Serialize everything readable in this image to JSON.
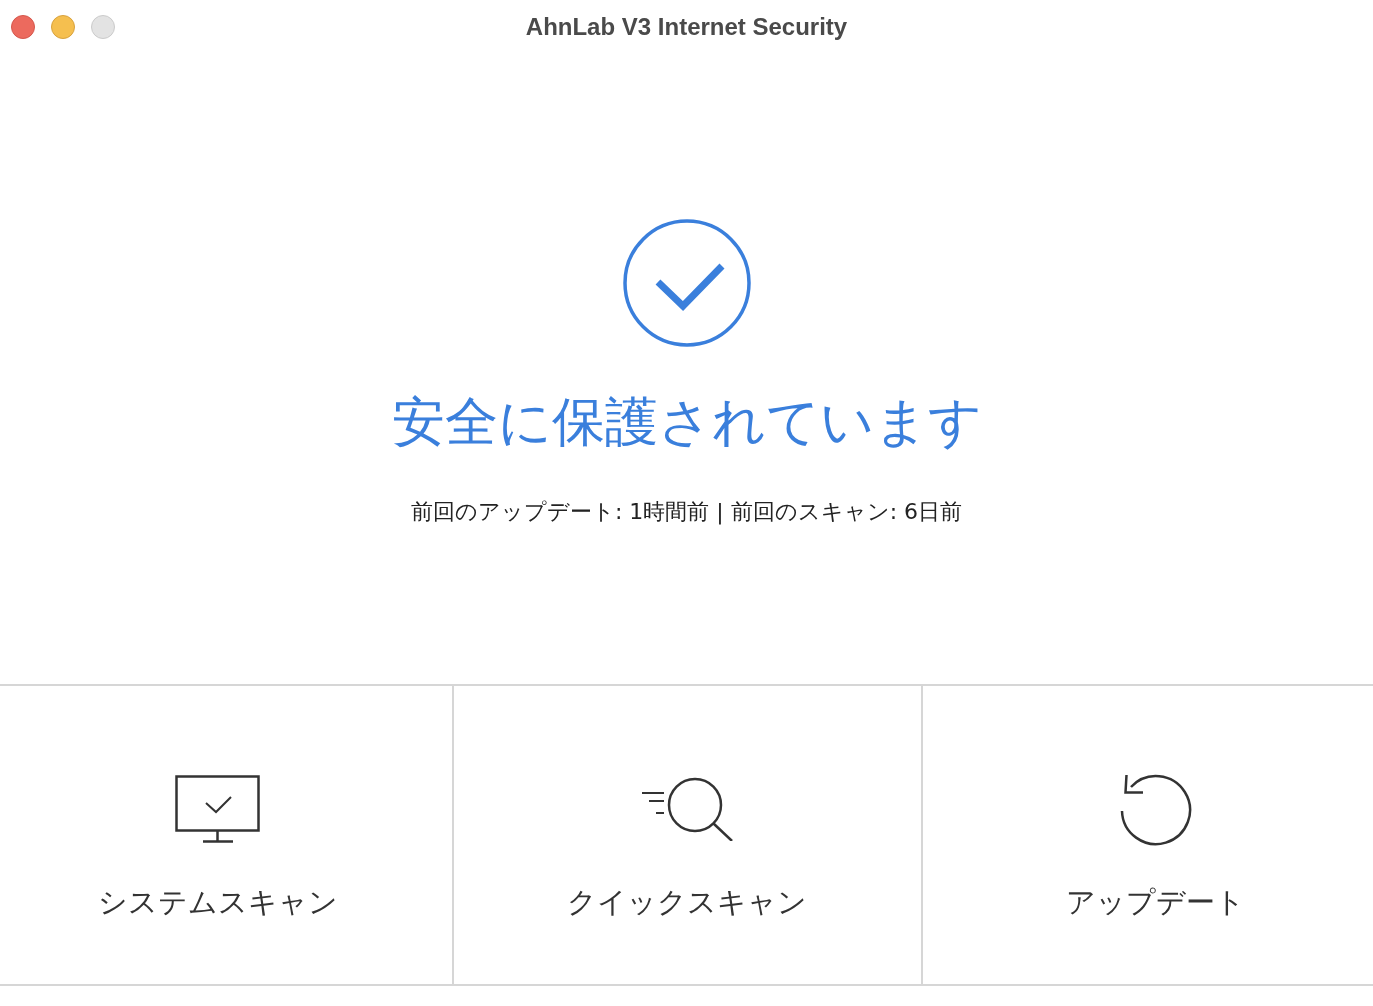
{
  "window": {
    "title": "AhnLab V3 Internet Security",
    "controls": [
      {
        "kind": "close",
        "disabled": false
      },
      {
        "kind": "minimize",
        "disabled": false
      },
      {
        "kind": "zoom",
        "disabled": true
      }
    ]
  },
  "status": {
    "headline": "安全に保護されています",
    "details": "前回のアップデート: 1時間前 | 前回のスキャン: 6日前"
  },
  "actions": [
    {
      "kind": "system_scan",
      "label": "システムスキャン"
    },
    {
      "kind": "quick_scan",
      "label": "クイックスキャン"
    },
    {
      "kind": "update",
      "label": "アップデート"
    }
  ]
}
